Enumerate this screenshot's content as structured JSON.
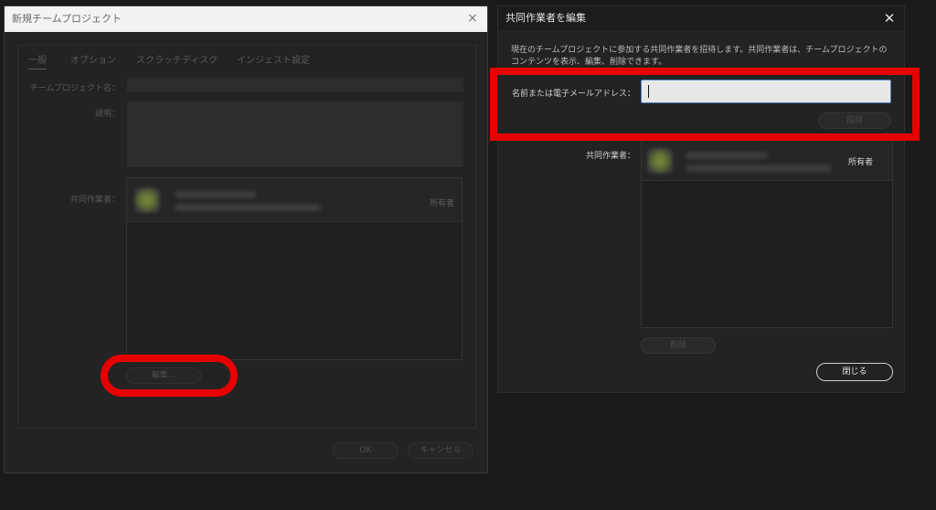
{
  "left_dialog": {
    "title": "新規チームプロジェクト",
    "close_glyph": "×",
    "tabs": [
      {
        "label": "一般",
        "active": true
      },
      {
        "label": "オプション",
        "active": false
      },
      {
        "label": "スクラッチディスク",
        "active": false
      },
      {
        "label": "インジェスト設定",
        "active": false
      }
    ],
    "labels": {
      "project_name": "チームプロジェクト名：",
      "description": "説明：",
      "collaborators": "共同作業者："
    },
    "collaborator": {
      "role": "所有者",
      "avatar_icon": "user-avatar-icon"
    },
    "buttons": {
      "edit": "編集...",
      "ok": "OK",
      "cancel": "キャンセル"
    }
  },
  "right_dialog": {
    "title": "共同作業者を編集",
    "close_glyph": "✕",
    "description": "現在のチームプロジェクトに参加する共同作業者を招待します。共同作業者は、チームプロジェクトのコンテンツを表示、編集、削除できます。",
    "email_label": "名前または電子メールアドレス：",
    "email_value": "",
    "invite_button": "招待",
    "collaborators_label": "共同作業者：",
    "collaborator": {
      "role": "所有者",
      "avatar_icon": "user-avatar-icon"
    },
    "delete_button": "削除",
    "close_button": "閉じる"
  },
  "colors": {
    "background": "#1b1b1b",
    "dialog_bg": "#232323",
    "highlight_red": "#e80000",
    "input_focus_border": "#4f82c4"
  }
}
